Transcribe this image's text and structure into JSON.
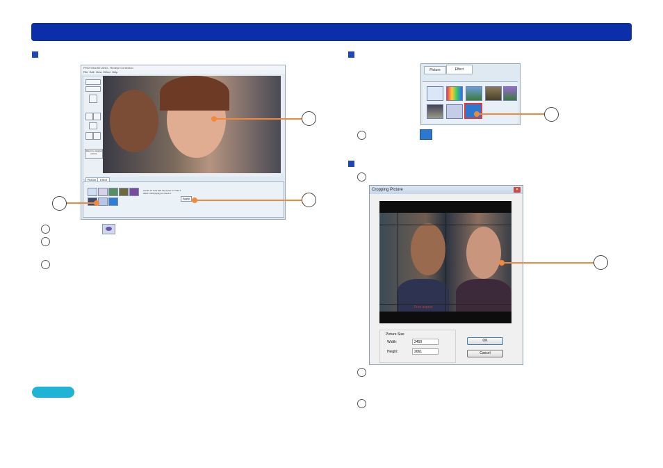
{
  "screenshot_left": {
    "title": "PHOTOfunSTUDIO - Redeye Correction",
    "menu": [
      "File",
      "Edit",
      "View",
      "Effect",
      "Help"
    ],
    "tabs": [
      "Picture",
      "Effect"
    ],
    "instruction": "Create an area with the cursor to make it effect. Click [Apply] to check it.",
    "apply_label": "Apply",
    "side_button": "Return to original picture"
  },
  "screenshot_effect": {
    "tabs": [
      "Picture",
      "Effect"
    ]
  },
  "screenshot_crop": {
    "title": "Cropping Picture",
    "overlay_text": "Free aspect",
    "group_label": "Picture Size",
    "width_label": "Width:",
    "width_value": "2459",
    "height_label": "Height:",
    "height_value": "2061",
    "ok_label": "OK",
    "cancel_label": "Cancel"
  }
}
